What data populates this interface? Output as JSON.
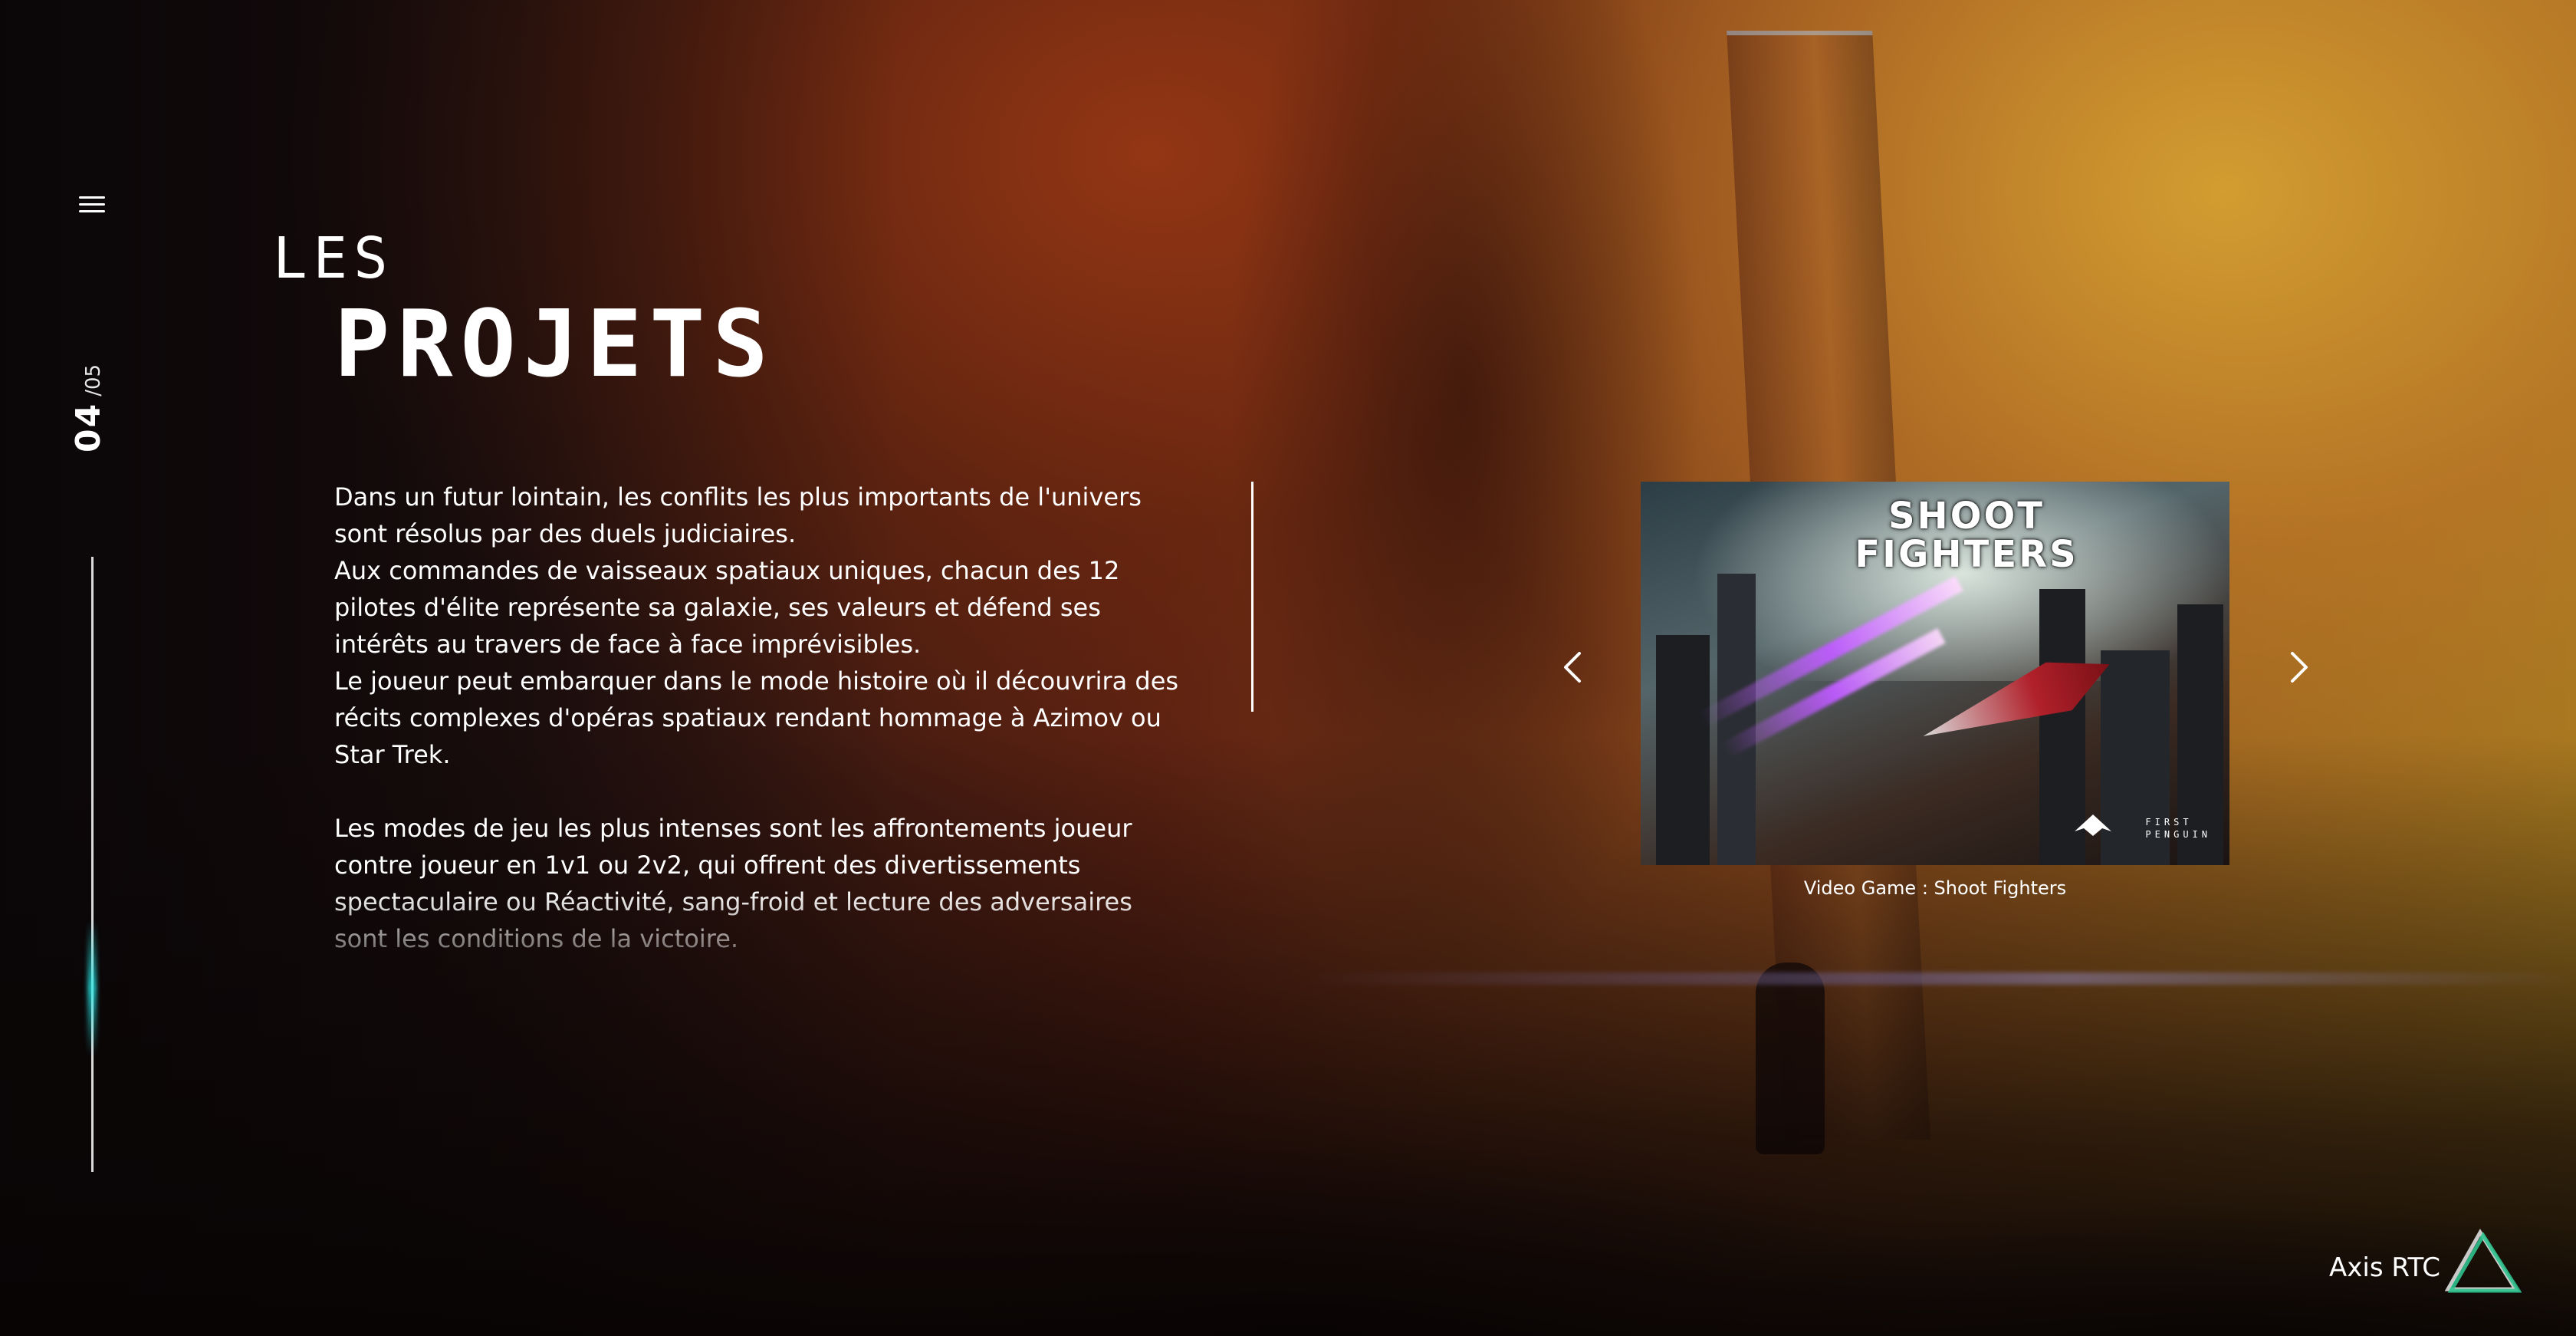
{
  "nav": {
    "menu_icon": "hamburger-menu-icon"
  },
  "pagination": {
    "current": "04",
    "total": "/05"
  },
  "section": {
    "title_small": "LES",
    "title_big": "PROJETS"
  },
  "description": {
    "paragraphs": [
      "Dans un futur lointain, les conflits les plus importants de l'univers sont résolus par des duels judiciaires.",
      "Aux commandes de vaisseaux spatiaux uniques, chacun des 12 pilotes d'élite représente sa galaxie, ses valeurs et défend ses intérêts au travers de face à face imprévisibles.",
      "Le joueur peut embarquer dans le mode histoire où il découvrira des récits complexes d'opéras spatiaux rendant hommage à Azimov ou Star Trek.",
      "Les modes de jeu les plus intenses sont les affrontements joueur contre joueur en 1v1 ou 2v2, qui offrent des divertissements spectaculaire ou Réactivité, sang-froid et lecture des adversaires sont les conditions de la victoire."
    ]
  },
  "carousel": {
    "prev_icon": "chevron-left-icon",
    "next_icon": "chevron-right-icon",
    "slide": {
      "title_line1": "SHOOT",
      "title_line2": "FIGHTERS",
      "studio_line1": "FIRST",
      "studio_line2": "PENGUIN",
      "caption": "Video Game : Shoot Fighters"
    }
  },
  "brand": {
    "name": "Axis RTC",
    "logo_icon": "triangle-logo-icon",
    "accent": "#2fc28f"
  }
}
